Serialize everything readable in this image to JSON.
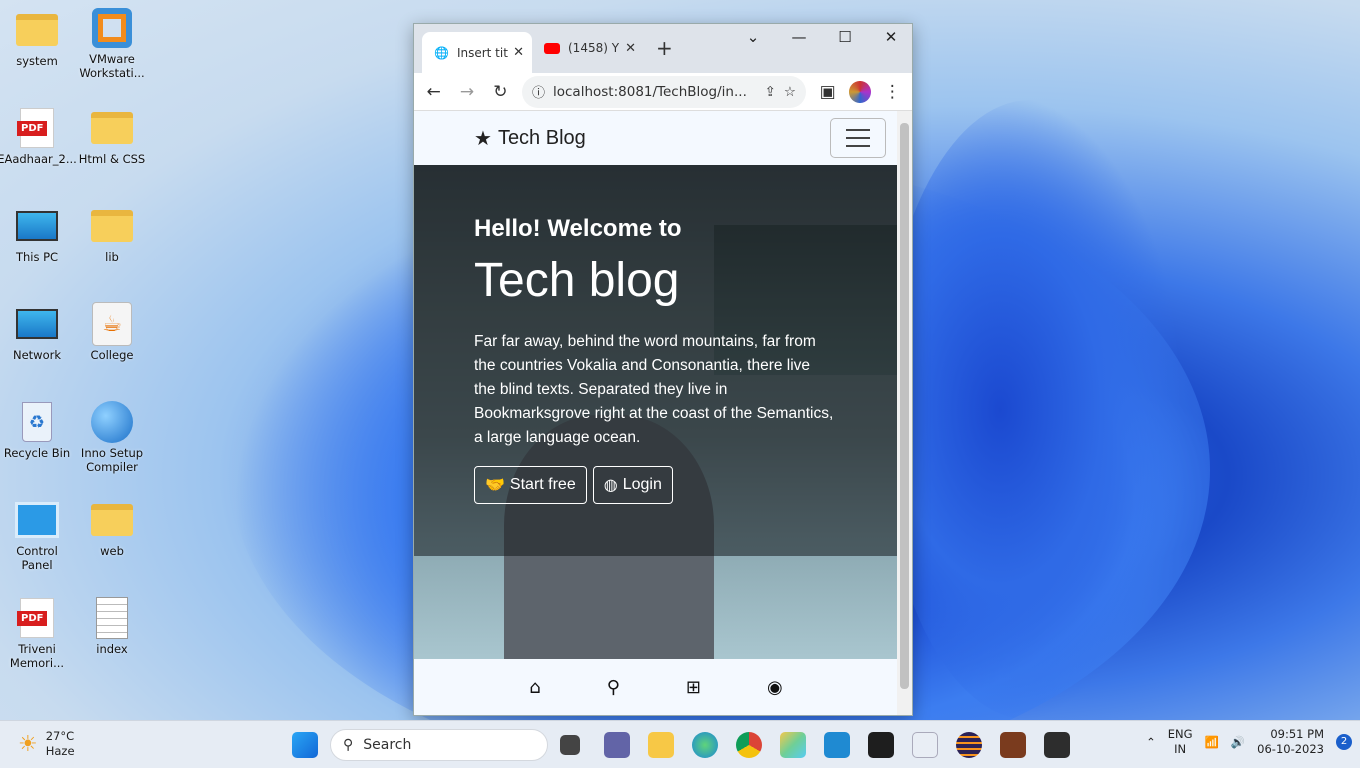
{
  "desktop": {
    "icons": [
      {
        "label": "system",
        "type": "folder"
      },
      {
        "label": "VMware Workstati...",
        "type": "app"
      },
      {
        "label": "EAadhaar_2...",
        "type": "pdf"
      },
      {
        "label": "Html & CSS",
        "type": "folder"
      },
      {
        "label": "This PC",
        "type": "monitor"
      },
      {
        "label": "lib",
        "type": "folder"
      },
      {
        "label": "Network",
        "type": "network"
      },
      {
        "label": "College",
        "type": "java"
      },
      {
        "label": "Recycle Bin",
        "type": "bin"
      },
      {
        "label": "Inno Setup Compiler",
        "type": "app"
      },
      {
        "label": "Control Panel",
        "type": "control"
      },
      {
        "label": "web",
        "type": "folder"
      },
      {
        "label": "Triveni Memori...",
        "type": "pdf"
      },
      {
        "label": "index",
        "type": "file"
      }
    ]
  },
  "browser": {
    "tabs": [
      {
        "label": "Insert tit",
        "icon": "globe-icon"
      },
      {
        "label": "(1458) Y",
        "icon": "youtube-icon"
      }
    ],
    "new_tab": "+",
    "url": "localhost:8081/TechBlog/in...",
    "window_controls": {
      "dropdown": "⌄",
      "minimize": "—",
      "maximize": "☐",
      "close": "✕"
    }
  },
  "page": {
    "brand": "Tech Blog",
    "hero": {
      "subtitle": "Hello! Welcome to",
      "title": "Tech blog",
      "text": "Far far away, behind the word mountains, far from the countries Vokalia and Consonantia, there live the blind texts. Separated they live in Bookmarksgrove right at the coast of the Semantics, a large language ocean.",
      "start_label": "Start free",
      "login_label": "Login"
    }
  },
  "taskbar": {
    "weather_temp": "27°C",
    "weather_desc": "Haze",
    "search_placeholder": "Search",
    "lang_top": "ENG",
    "lang_bottom": "IN",
    "time": "09:51 PM",
    "date": "06-10-2023",
    "notification_count": "2"
  }
}
